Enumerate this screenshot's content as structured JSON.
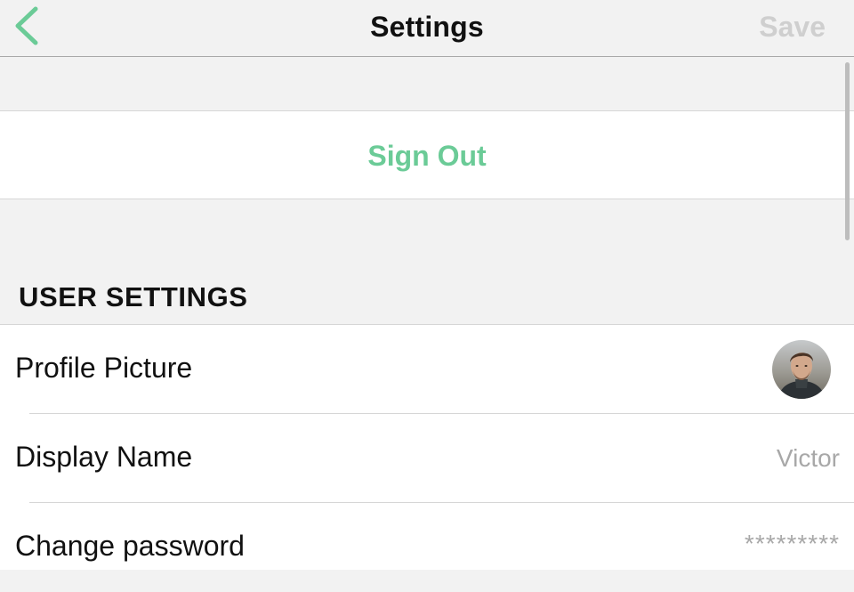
{
  "header": {
    "title": "Settings",
    "save_label": "Save",
    "back_icon": "chevron-left-icon"
  },
  "sign_out": {
    "label": "Sign Out"
  },
  "user_settings": {
    "header": "USER SETTINGS",
    "rows": [
      {
        "label": "Profile Picture",
        "value": "",
        "icon": "avatar"
      },
      {
        "label": "Display Name",
        "value": "Victor"
      },
      {
        "label": "Change password",
        "value": "*********"
      }
    ]
  },
  "colors": {
    "accent": "#6bcb97",
    "disabled": "#cfcfcf",
    "secondary_text": "#a8a8a8",
    "background": "#f2f2f2"
  }
}
